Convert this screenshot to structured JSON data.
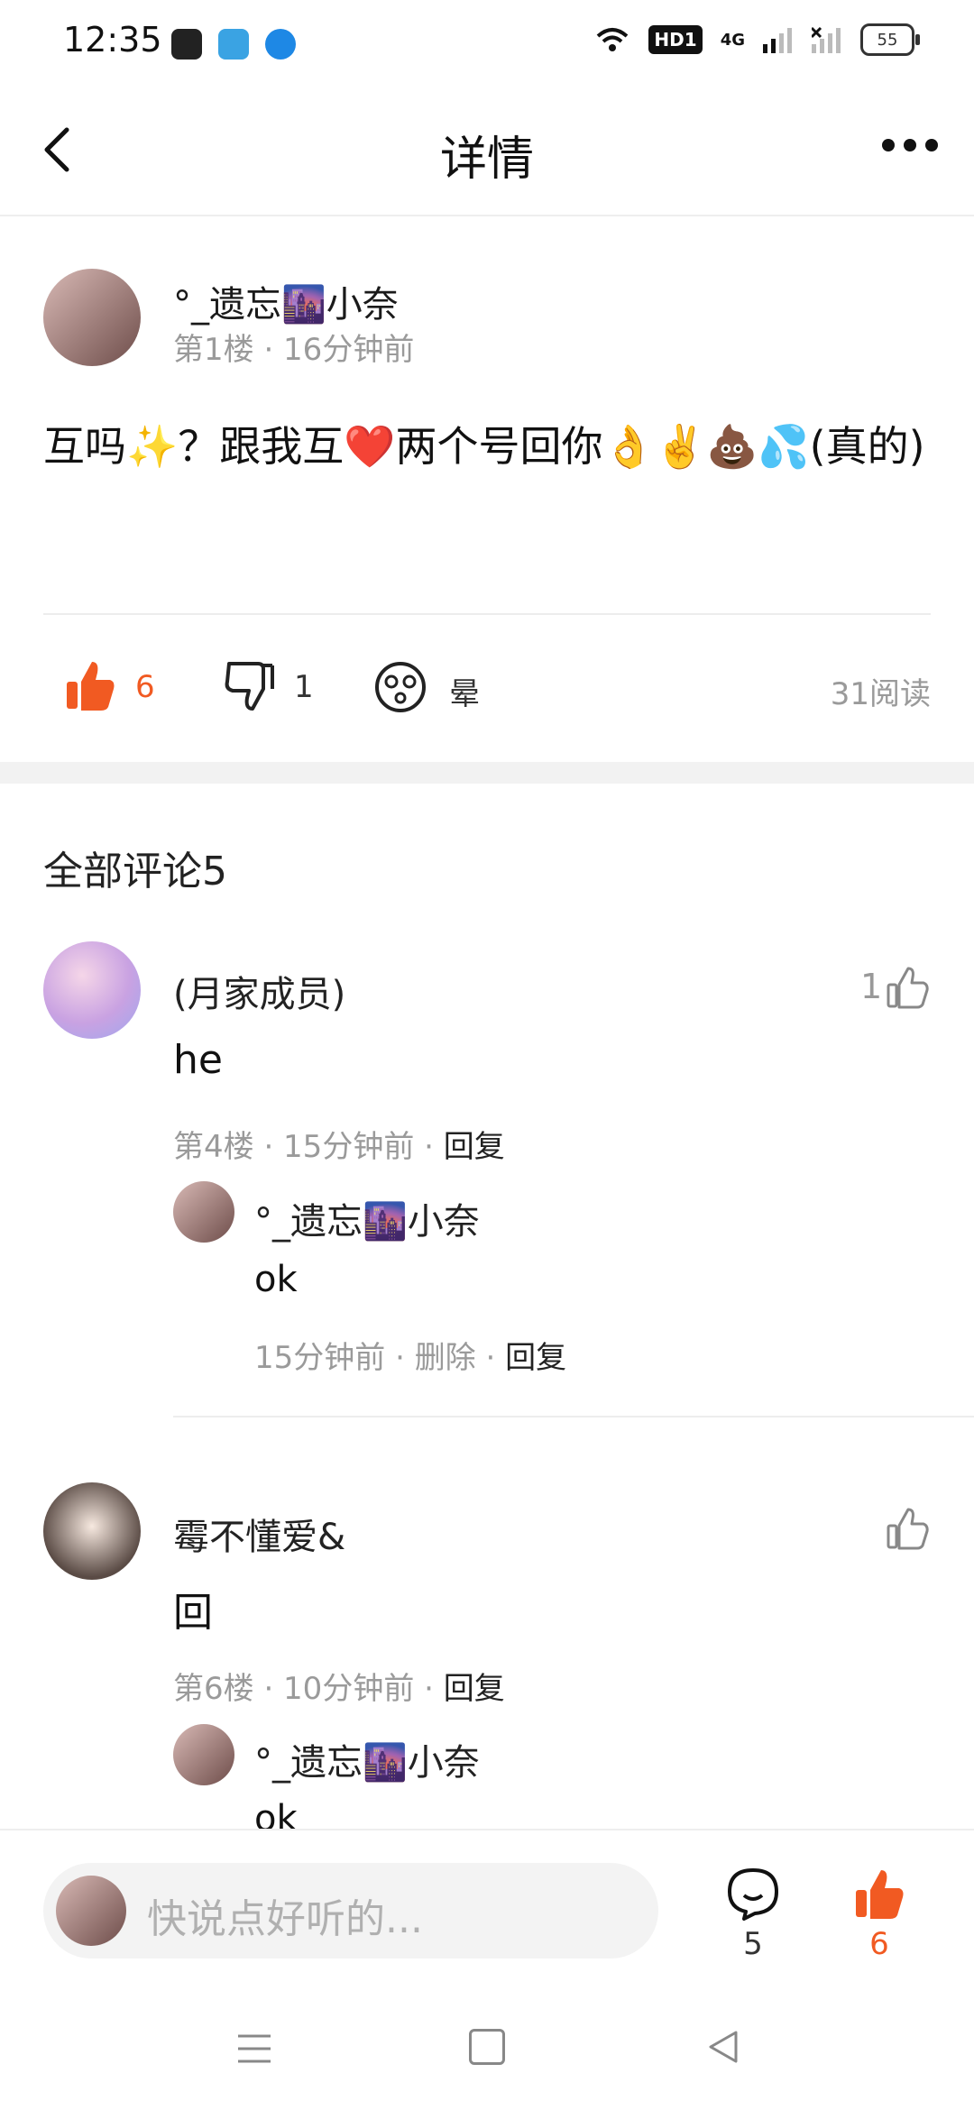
{
  "status_bar": {
    "time": "12:35",
    "network": "4G",
    "hd": "HD1",
    "battery": "55"
  },
  "header": {
    "title": "详情"
  },
  "post": {
    "author": "°_遗忘🌆小奈",
    "meta": "第1楼 · 16分钟前",
    "content": "互吗✨？跟我互❤️两个号回你👌✌️💩💦(真的)",
    "likes": "6",
    "dislikes": "1",
    "reaction_label": "晕",
    "reads": "31阅读"
  },
  "comments_section": {
    "title": "全部评论5",
    "comments": [
      {
        "name": "(月家成员)",
        "text": "he",
        "likes": "1",
        "meta_time": "第4楼 · 15分钟前 · ",
        "reply_label": "回复",
        "reply": {
          "name": "°_遗忘🌆小奈",
          "text": "ok",
          "meta_time": "15分钟前 · ",
          "delete_label": "删除",
          "sep": " · ",
          "reply_label": "回复"
        }
      },
      {
        "name": "霉不懂爱&",
        "text": "回",
        "likes": "",
        "meta_time": "第6楼 · 10分钟前 · ",
        "reply_label": "回复",
        "reply": {
          "name": "°_遗忘🌆小奈",
          "text": "ok"
        }
      }
    ]
  },
  "bottom_bar": {
    "placeholder": "快说点好听的...",
    "comment_count": "5",
    "like_count": "6"
  },
  "colors": {
    "accent": "#f15a22",
    "muted": "#9a9a9a"
  }
}
